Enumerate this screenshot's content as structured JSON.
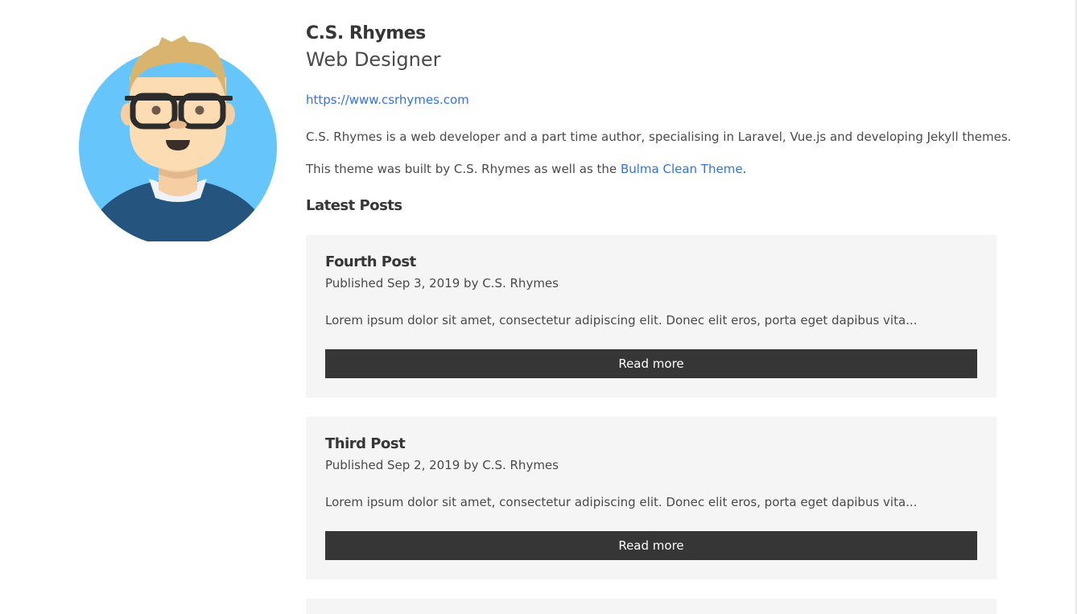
{
  "author": {
    "name": "C.S. Rhymes",
    "role": "Web Designer",
    "website": "https://www.csrhymes.com",
    "avatar_icon": "cartoon-avatar-icon"
  },
  "bio": {
    "line1": "C.S. Rhymes is a web developer and a part time author, specialising in Laravel, Vue.js and developing Jekyll themes.",
    "line2_prefix": "This theme was built by C.S. Rhymes as well as the ",
    "line2_link": "Bulma Clean Theme",
    "line2_suffix": "."
  },
  "latest_posts": {
    "heading": "Latest Posts",
    "read_more_label": "Read more",
    "posts": [
      {
        "title": "Fourth Post",
        "meta": "Published Sep 3, 2019 by C.S. Rhymes",
        "excerpt": "Lorem ipsum dolor sit amet, consectetur adipiscing elit. Donec elit eros, porta eget dapibus vita..."
      },
      {
        "title": "Third Post",
        "meta": "Published Sep 2, 2019 by C.S. Rhymes",
        "excerpt": "Lorem ipsum dolor sit amet, consectetur adipiscing elit. Donec elit eros, porta eget dapibus vita..."
      }
    ]
  },
  "colors": {
    "link": "#3273dc",
    "heading": "#363636",
    "text": "#4a4a4a",
    "card_bg": "#f5f5f5",
    "button_bg": "#363636",
    "avatar_bg": "#66c6fc",
    "sweater": "#25557f"
  }
}
